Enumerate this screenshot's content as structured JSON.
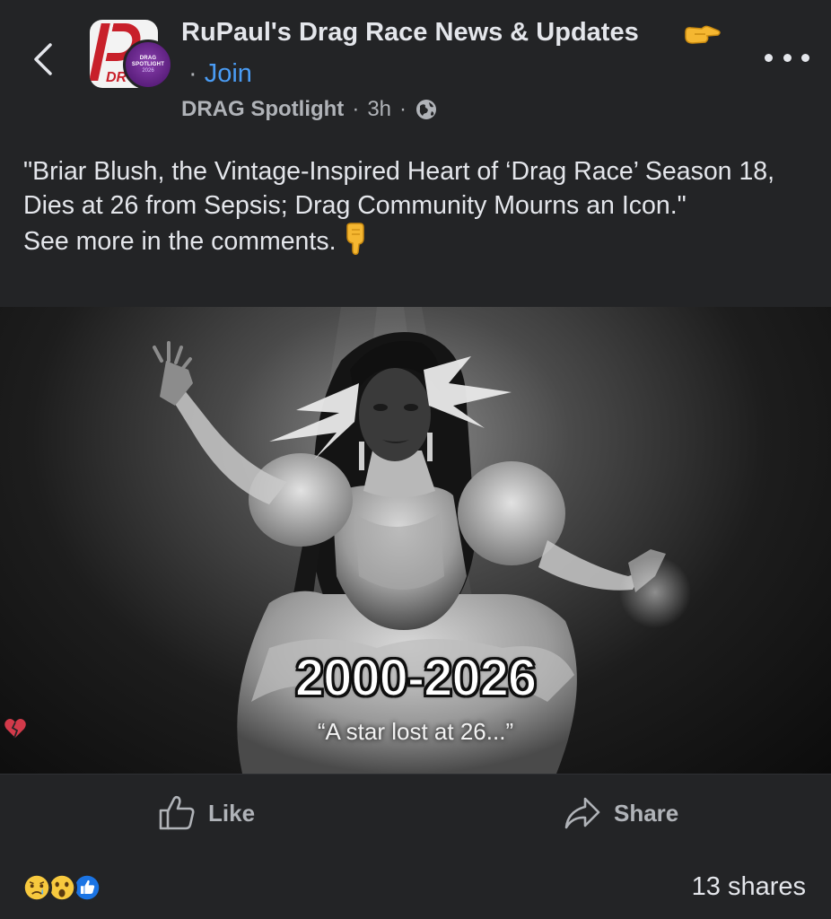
{
  "header": {
    "group_name": "RuPaul's Drag Race News & Updates",
    "join_prefix": "·",
    "join_label": "Join",
    "author": "DRAG Spotlight",
    "time": "3h",
    "avatar_badge_line1": "DRAG SPOTLIGHT",
    "avatar_badge_line2": "2026"
  },
  "post": {
    "text_lines": [
      "\"Briar Blush, the Vintage-Inspired Heart of ‘Drag Race’ Season 18, Dies at 26 from Sepsis; Drag Community Mourns an Icon.\"",
      "See more in the comments."
    ]
  },
  "image": {
    "years": "2000-2026",
    "quote_text": "“A star lost at 26...",
    "quote_close": "”"
  },
  "actions": {
    "like_label": "Like",
    "share_label": "Share"
  },
  "footer": {
    "shares_text": "13 shares",
    "reactions": [
      "sad-emoji",
      "wow-emoji",
      "like-emoji"
    ]
  },
  "colors": {
    "background": "#232426",
    "text": "#e4e6eb",
    "muted": "#b0b3b8",
    "accent": "#4a9cf4"
  }
}
